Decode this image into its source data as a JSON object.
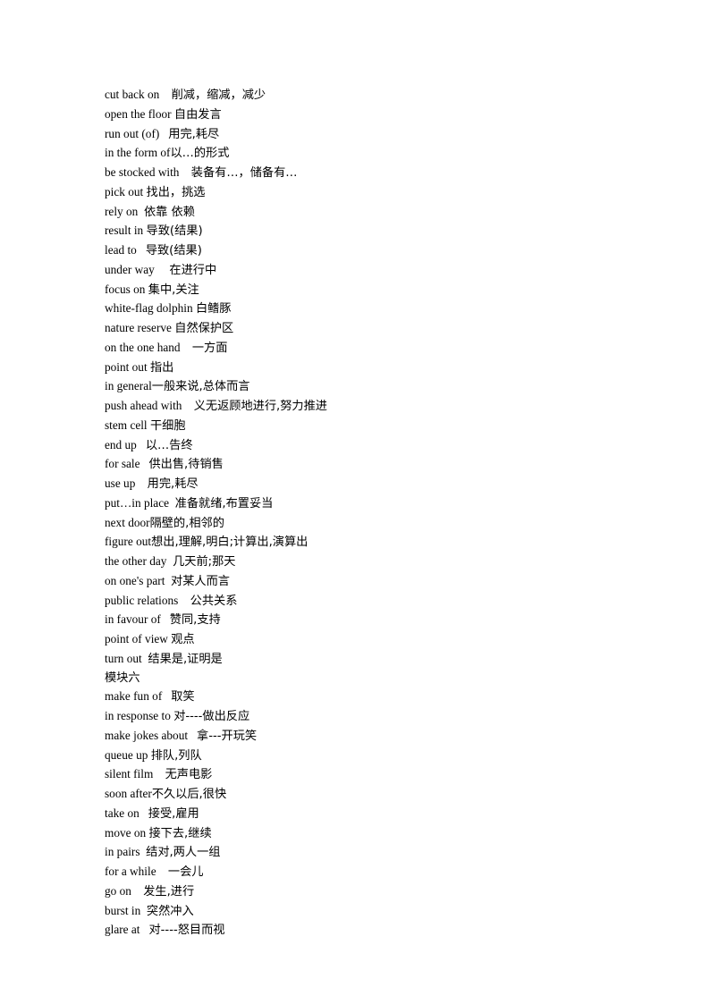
{
  "document": {
    "type": "vocabulary-phrase-list",
    "language_pair": "English-Chinese",
    "lines": [
      {
        "kind": "entry",
        "term": "cut back on",
        "gap": "    ",
        "gloss": "削减，缩减，减少"
      },
      {
        "kind": "entry",
        "term": "open the floor",
        "gap": " ",
        "gloss": "自由发言"
      },
      {
        "kind": "entry",
        "term": "run out (of)",
        "gap": "   ",
        "gloss": "用完,耗尽"
      },
      {
        "kind": "entry",
        "term": "in the form of",
        "gap": "",
        "gloss": "以…的形式"
      },
      {
        "kind": "entry",
        "term": "be stocked with",
        "gap": "    ",
        "gloss": "装备有…，储备有…"
      },
      {
        "kind": "entry",
        "term": "pick out",
        "gap": " ",
        "gloss": "找出，挑选"
      },
      {
        "kind": "entry",
        "term": "rely on",
        "gap": "  ",
        "gloss": "依靠 依赖"
      },
      {
        "kind": "entry",
        "term": "result in",
        "gap": " ",
        "gloss": "导致(结果)"
      },
      {
        "kind": "entry",
        "term": "lead to",
        "gap": "   ",
        "gloss": "导致(结果)"
      },
      {
        "kind": "entry",
        "term": "under way",
        "gap": "     ",
        "gloss": "在进行中"
      },
      {
        "kind": "entry",
        "term": "focus on",
        "gap": " ",
        "gloss": "集中,关注"
      },
      {
        "kind": "entry",
        "term": "white-flag dolphin",
        "gap": " ",
        "gloss": "白鳍豚"
      },
      {
        "kind": "entry",
        "term": "nature reserve",
        "gap": " ",
        "gloss": "自然保护区"
      },
      {
        "kind": "entry",
        "term": "on the one hand",
        "gap": "    ",
        "gloss": "一方面"
      },
      {
        "kind": "entry",
        "term": "point out",
        "gap": " ",
        "gloss": "指出"
      },
      {
        "kind": "entry",
        "term": "in general",
        "gap": "",
        "gloss": "一般来说,总体而言"
      },
      {
        "kind": "entry",
        "term": "push ahead with",
        "gap": "    ",
        "gloss": "义无返顾地进行,努力推进"
      },
      {
        "kind": "entry",
        "term": "stem cell",
        "gap": " ",
        "gloss": "干细胞"
      },
      {
        "kind": "entry",
        "term": "end up",
        "gap": "   ",
        "gloss": "以…告终"
      },
      {
        "kind": "entry",
        "term": "for sale",
        "gap": "   ",
        "gloss": "供出售,待销售"
      },
      {
        "kind": "entry",
        "term": "use up",
        "gap": "    ",
        "gloss": "用完,耗尽"
      },
      {
        "kind": "entry",
        "term": "put…in place",
        "gap": "  ",
        "gloss": "准备就绪,布置妥当"
      },
      {
        "kind": "entry",
        "term": "next door",
        "gap": "",
        "gloss": "隔壁的,相邻的"
      },
      {
        "kind": "entry",
        "term": "figure out",
        "gap": "",
        "gloss": "想出,理解,明白;计算出,演算出"
      },
      {
        "kind": "entry",
        "term": "the other day",
        "gap": "  ",
        "gloss": "几天前;那天"
      },
      {
        "kind": "entry",
        "term": "on one's part",
        "gap": "  ",
        "gloss": "对某人而言"
      },
      {
        "kind": "entry",
        "term": "public relations",
        "gap": "    ",
        "gloss": "公共关系"
      },
      {
        "kind": "entry",
        "term": "in favour of",
        "gap": "   ",
        "gloss": "赞同,支持"
      },
      {
        "kind": "entry",
        "term": "point of view",
        "gap": " ",
        "gloss": "观点"
      },
      {
        "kind": "entry",
        "term": "turn out",
        "gap": "  ",
        "gloss": "结果是,证明是"
      },
      {
        "kind": "heading",
        "text": "模块六"
      },
      {
        "kind": "entry",
        "term": "make fun of",
        "gap": "   ",
        "gloss": "取笑"
      },
      {
        "kind": "entry",
        "term": "in response to",
        "gap": " ",
        "gloss": "对----做出反应"
      },
      {
        "kind": "entry",
        "term": "make jokes about",
        "gap": "   ",
        "gloss": "拿---开玩笑"
      },
      {
        "kind": "entry",
        "term": "queue up",
        "gap": " ",
        "gloss": "排队,列队"
      },
      {
        "kind": "entry",
        "term": "silent film",
        "gap": "    ",
        "gloss": "无声电影"
      },
      {
        "kind": "entry",
        "term": "soon after",
        "gap": "",
        "gloss": "不久以后,很快"
      },
      {
        "kind": "entry",
        "term": "take on",
        "gap": "   ",
        "gloss": "接受,雇用"
      },
      {
        "kind": "entry",
        "term": "move on",
        "gap": " ",
        "gloss": "接下去,继续"
      },
      {
        "kind": "entry",
        "term": "in pairs",
        "gap": "  ",
        "gloss": "结对,两人一组"
      },
      {
        "kind": "entry",
        "term": "for a while",
        "gap": "    ",
        "gloss": "一会儿"
      },
      {
        "kind": "entry",
        "term": "go on",
        "gap": "    ",
        "gloss": "发生,进行"
      },
      {
        "kind": "entry",
        "term": "burst in",
        "gap": "  ",
        "gloss": "突然冲入"
      },
      {
        "kind": "entry",
        "term": "glare at",
        "gap": "   ",
        "gloss": "对----怒目而视"
      }
    ]
  }
}
